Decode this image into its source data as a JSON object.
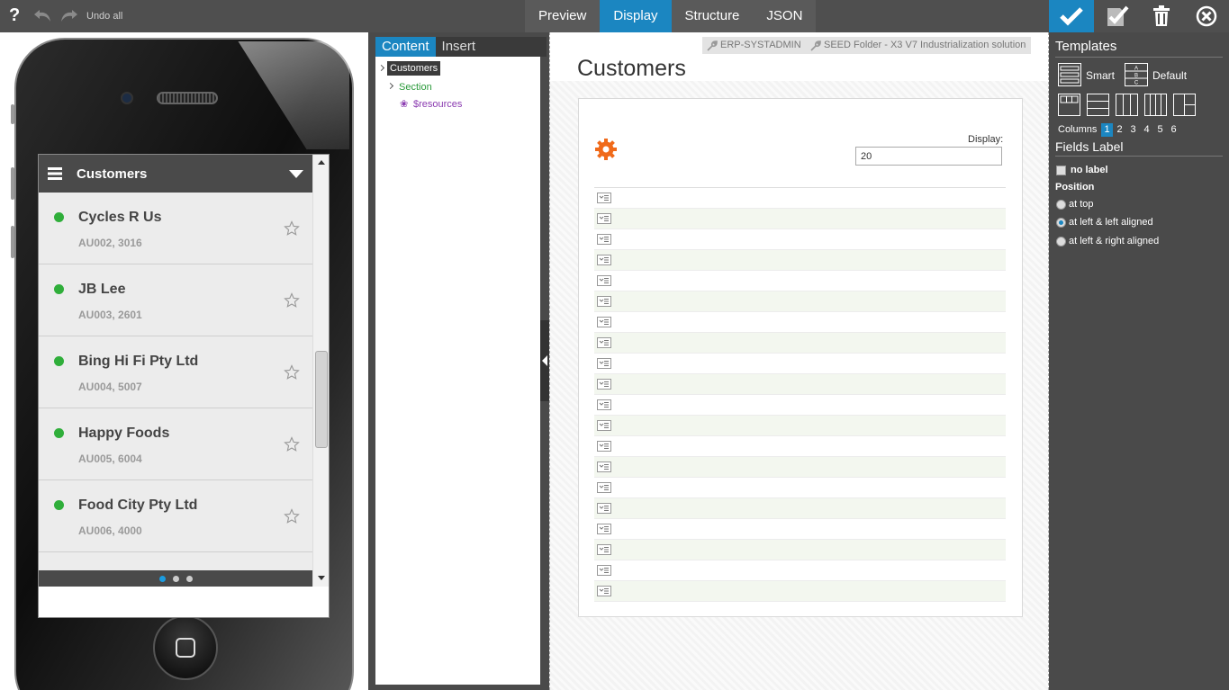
{
  "toolbar": {
    "help": "?",
    "undo_all": "Undo all",
    "tabs": [
      "Preview",
      "Display",
      "Structure",
      "JSON"
    ],
    "active_tab": "Display",
    "accent": "#1b86c1"
  },
  "mobile": {
    "header_title": "Customers",
    "items": [
      {
        "name": "Cycles R Us",
        "code": "AU002, 3016"
      },
      {
        "name": "JB Lee",
        "code": "AU003, 2601"
      },
      {
        "name": "Bing Hi Fi Pty Ltd",
        "code": "AU004, 5007"
      },
      {
        "name": "Happy Foods",
        "code": "AU005, 6004"
      },
      {
        "name": "Food City Pty Ltd",
        "code": "AU006, 4000"
      }
    ],
    "status_color": "#2fae3a",
    "pages": 3,
    "current_page": 1
  },
  "tree": {
    "tabs": [
      "Content",
      "Insert"
    ],
    "active_tab": "Content",
    "nodes": {
      "root": "Customers",
      "section": "Section",
      "resources": "$resources"
    }
  },
  "canvas": {
    "breadcrumbs": [
      "ERP-SYSTADMIN",
      "SEED Folder - X3 V7 Industrialization solution"
    ],
    "title": "Customers",
    "display_label": "Display:",
    "display_value": "20",
    "row_count": 20
  },
  "panel": {
    "templates_heading": "Templates",
    "template_smart": "Smart",
    "template_default": "Default",
    "columns_label": "Columns",
    "columns": [
      "1",
      "2",
      "3",
      "4",
      "5",
      "6"
    ],
    "selected_column": "1",
    "fields_label_heading": "Fields Label",
    "no_label": "no label",
    "position_label": "Position",
    "positions": [
      "at top",
      "at left & left aligned",
      "at left & right aligned"
    ],
    "selected_position": "at left & left aligned"
  }
}
